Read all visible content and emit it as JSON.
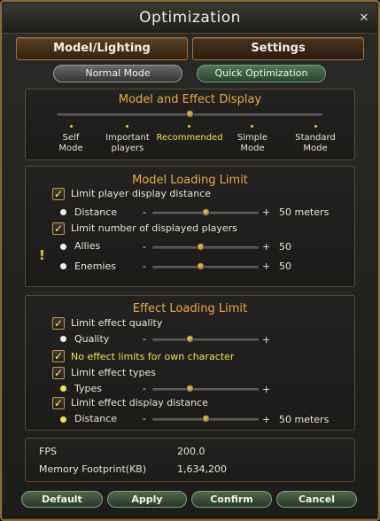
{
  "window": {
    "title": "Optimization",
    "close_glyph": "✕"
  },
  "tabs": [
    {
      "label": "Model/Lighting"
    },
    {
      "label": "Settings"
    }
  ],
  "modes": {
    "normal": "Normal Mode",
    "quick": "Quick Optimization"
  },
  "model_effect_display": {
    "title": "Model and Effect Display",
    "selected_index": 2,
    "options": [
      {
        "line1": "Self",
        "line2": "Mode"
      },
      {
        "line1": "Important",
        "line2": "players"
      },
      {
        "line1": "Recommended",
        "line2": ""
      },
      {
        "line1": "Simple",
        "line2": "Mode"
      },
      {
        "line1": "Standard",
        "line2": "Mode"
      }
    ]
  },
  "model_loading_limit": {
    "title": "Model Loading Limit",
    "limit_player_distance": {
      "label": "Limit player display distance",
      "checked": true
    },
    "distance": {
      "label": "Distance",
      "minus": "-",
      "plus": "+",
      "value": "50 meters",
      "level": 0.5
    },
    "limit_player_count": {
      "label": "Limit number of displayed players",
      "checked": true
    },
    "allies": {
      "label": "Allies",
      "minus": "-",
      "plus": "+",
      "value": "50",
      "level": 0.45
    },
    "enemies": {
      "label": "Enemies",
      "minus": "-",
      "plus": "+",
      "value": "50",
      "level": 0.45
    },
    "warning_glyph": "!"
  },
  "effect_loading_limit": {
    "title": "Effect Loading Limit",
    "limit_effect_quality": {
      "label": "Limit effect quality",
      "checked": true
    },
    "quality": {
      "label": "Quality",
      "minus": "-",
      "plus": "+",
      "level": 0.35
    },
    "no_limits_own": {
      "label": "No effect limits for own character",
      "checked": true
    },
    "limit_effect_types": {
      "label": "Limit effect types",
      "checked": true
    },
    "types": {
      "label": "Types",
      "minus": "-",
      "plus": "+",
      "level": 0.35
    },
    "limit_effect_distance": {
      "label": "Limit effect display distance",
      "checked": true
    },
    "distance": {
      "label": "Distance",
      "minus": "-",
      "plus": "+",
      "value": "50 meters",
      "level": 0.5
    }
  },
  "stats": {
    "fps_label": "FPS",
    "fps_value": "200.0",
    "memory_label": "Memory Footprint(KB)",
    "memory_value": "1,634,200"
  },
  "buttons": {
    "default": "Default",
    "apply": "Apply",
    "confirm": "Confirm",
    "cancel": "Cancel"
  },
  "check_glyph": "✓"
}
